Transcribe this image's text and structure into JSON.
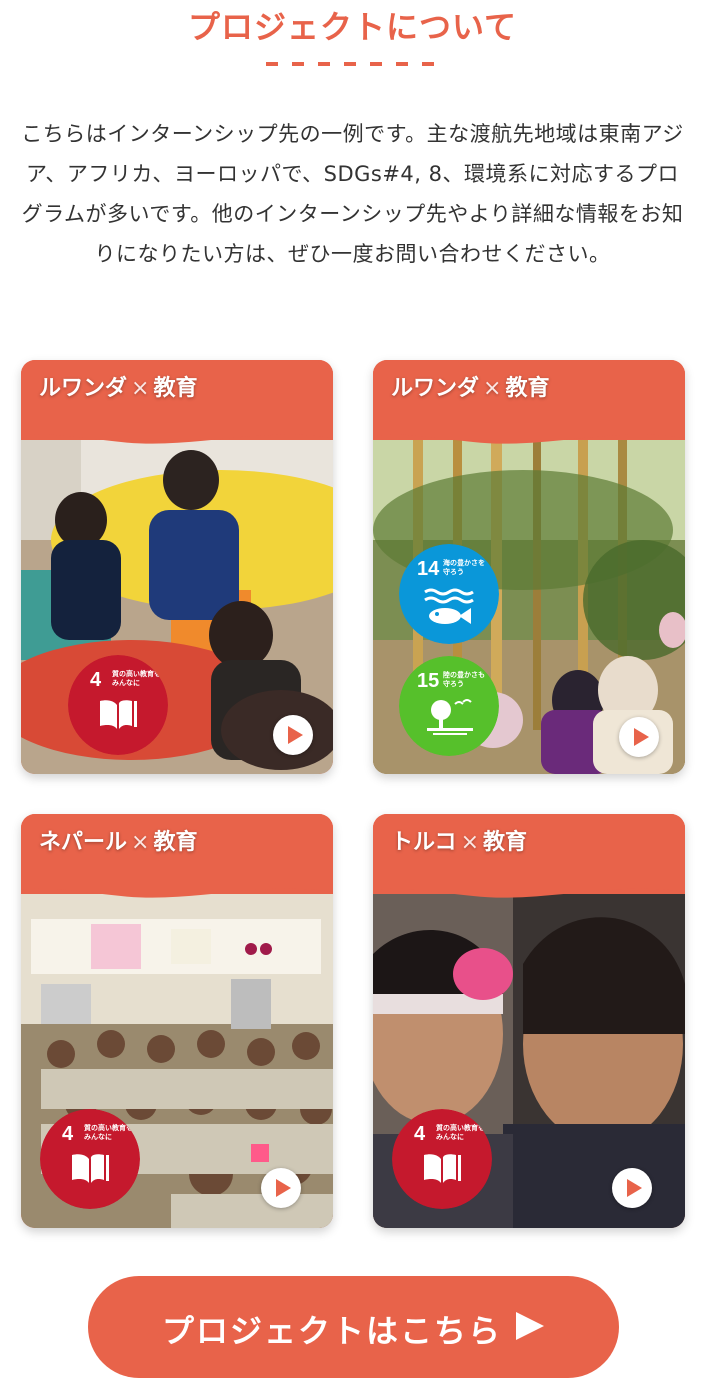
{
  "section": {
    "title": "プロジェクトについて",
    "intro": "こちらはインターンシップ先の一例です。主な渡航先地域は東南アジア、アフリカ、ヨーロッパで、SDGs#4, 8、環境系に対応するプログラムが多いです。他のインターンシップ先やより詳細な情報をお知りになりたい方は、ぜひ一度お問い合わせください。"
  },
  "cards": [
    {
      "country": "ルワンダ",
      "sep": "×",
      "field": "教育",
      "sdgs": [
        {
          "num": "4",
          "text": "質の高い教育を みんなに",
          "color": "#c5192d",
          "icon": "book-icon"
        }
      ]
    },
    {
      "country": "ルワンダ",
      "sep": "×",
      "field": "教育",
      "sdgs": [
        {
          "num": "14",
          "text": "海の豊かさを 守ろう",
          "color": "#0a97d9",
          "icon": "fish-icon"
        },
        {
          "num": "15",
          "text": "陸の豊かさも 守ろう",
          "color": "#56c02b",
          "icon": "tree-icon"
        }
      ]
    },
    {
      "country": "ネパール",
      "sep": "×",
      "field": "教育",
      "sdgs": [
        {
          "num": "4",
          "text": "質の高い教育を みんなに",
          "color": "#c5192d",
          "icon": "book-icon"
        }
      ]
    },
    {
      "country": "トルコ",
      "sep": "×",
      "field": "教育",
      "sdgs": [
        {
          "num": "4",
          "text": "質の高い教育を みんなに",
          "color": "#c5192d",
          "icon": "book-icon"
        }
      ]
    }
  ],
  "cta": {
    "label": "プロジェクトはこちら",
    "icon": "play-arrow-icon"
  },
  "colors": {
    "accent": "#e8634a",
    "sdg4": "#c5192d",
    "sdg14": "#0a97d9",
    "sdg15": "#56c02b"
  }
}
